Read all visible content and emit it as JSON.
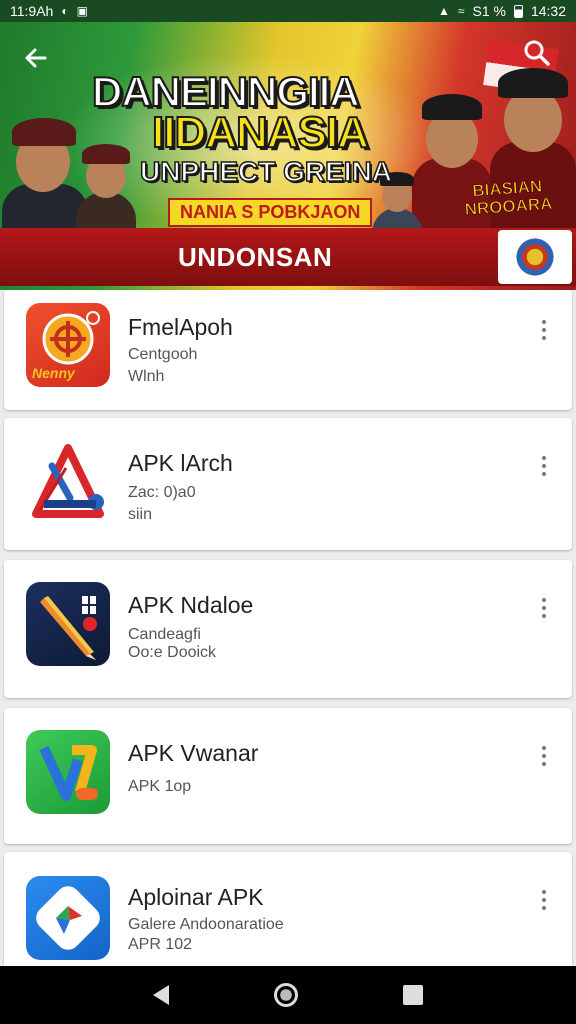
{
  "status_bar": {
    "time_left": "11:9Ah",
    "right_text": "S1 %",
    "clock": "14:32"
  },
  "banner": {
    "title_line1": "DANEINNGIIA",
    "title_line2": "IIDANASIA",
    "title_line3": "UNPHECT GREINA",
    "tagline": "NANIA S POBKJAON",
    "side_badge_line1": "BIASIAN",
    "side_badge_line2": "NROOARA",
    "ribbon_text": "UNDONSAN",
    "back_icon": "arrow-left-icon",
    "search_icon": "search-icon",
    "colors": {
      "green": "#2e9a3a",
      "yellow": "#f0d23a",
      "red": "#b41818"
    }
  },
  "apps": [
    {
      "name": "FmelApoh",
      "sub1": "Centgooh",
      "sub2": "Wlnh",
      "icon_label": "Nenny",
      "icon": "target-app-icon"
    },
    {
      "name": "APK lArch",
      "sub1": "Zac: 0)a0",
      "sub2": "siin",
      "icon": "apk-archer-icon"
    },
    {
      "name": "APK Ndaloe",
      "sub1": "Candeagfi",
      "sub2": "Oo:e Dooick",
      "icon": "pencil-app-icon"
    },
    {
      "name": "APK Vwanar",
      "sub1": "APK 1op",
      "sub2": "",
      "icon": "vwanar-app-icon"
    },
    {
      "name": "Aploinar APK",
      "sub1": "Galere Andoonaratioe",
      "sub2": "APR 102",
      "icon": "aploinar-app-icon"
    }
  ],
  "navbar": {
    "back_icon": "nav-back-icon",
    "home_icon": "nav-home-icon",
    "recents_icon": "nav-recents-icon"
  }
}
